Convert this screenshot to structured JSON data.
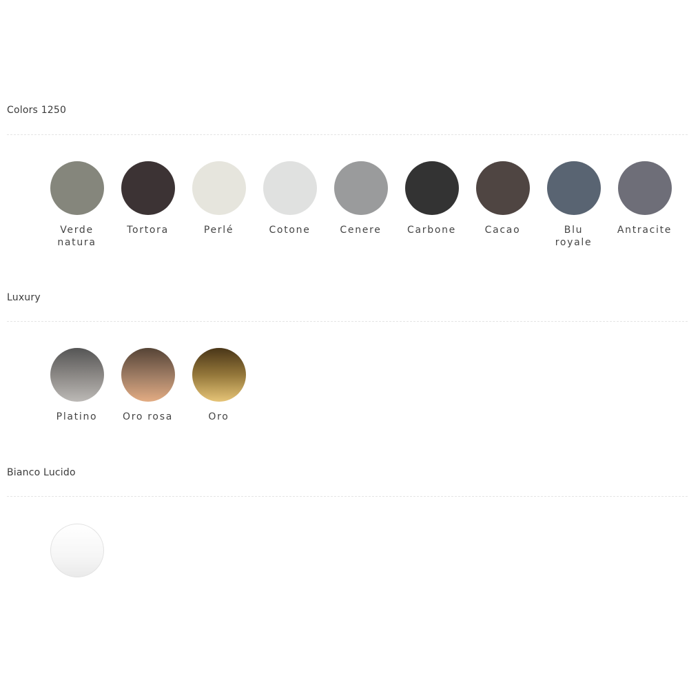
{
  "sections": [
    {
      "title": "Colors 1250",
      "swatches": [
        {
          "label": "Verde\nnatura",
          "fill": "#85867c"
        },
        {
          "label": "Tortora",
          "fill": "#3c3334"
        },
        {
          "label": "Perlé",
          "fill": "#e6e5dd"
        },
        {
          "label": "Cotone",
          "fill": "#e0e1e0"
        },
        {
          "label": "Cenere",
          "fill": "#9a9b9c"
        },
        {
          "label": "Carbone",
          "fill": "#333333"
        },
        {
          "label": "Cacao",
          "fill": "#4f4542"
        },
        {
          "label": "Blu\nroyale",
          "fill": "#596472"
        },
        {
          "label": "Antracite",
          "fill": "#6e6e78"
        }
      ]
    },
    {
      "title": "Luxury",
      "swatches": [
        {
          "label": "Platino",
          "fill": "linear-gradient(to bottom, #555555 0%, #8a8784 50%, #bcb9b6 100%)"
        },
        {
          "label": "Oro rosa",
          "fill": "linear-gradient(to bottom, #564436 0%, #a27f66 55%, #e3ac83 100%)"
        },
        {
          "label": "Oro",
          "fill": "linear-gradient(to bottom, #4a3618 0%, #94773a 50%, #e6c477 100%)"
        }
      ]
    },
    {
      "title": "Bianco Lucido",
      "swatches": [
        {
          "label": "",
          "fill": "linear-gradient(to bottom, #ffffff 0%, #f6f6f6 60%, #eaeaea 100%)",
          "border": "#e2e2e2"
        }
      ]
    }
  ]
}
